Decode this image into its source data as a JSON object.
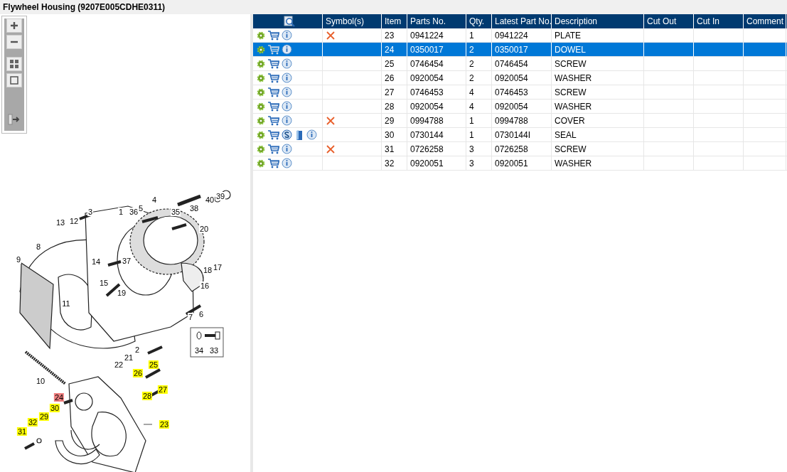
{
  "title": "Flywheel Housing (9207E005CDHE0311)",
  "diagram": {
    "callouts": [
      {
        "label": "4",
        "kind": "plain"
      },
      {
        "label": "40",
        "kind": "plain"
      },
      {
        "label": "39",
        "kind": "plain"
      },
      {
        "label": "3",
        "kind": "plain"
      },
      {
        "label": "1",
        "kind": "plain"
      },
      {
        "label": "36",
        "kind": "plain"
      },
      {
        "label": "5",
        "kind": "plain"
      },
      {
        "label": "35",
        "kind": "plain"
      },
      {
        "label": "38",
        "kind": "plain"
      },
      {
        "label": "13",
        "kind": "plain"
      },
      {
        "label": "12",
        "kind": "plain"
      },
      {
        "label": "20",
        "kind": "plain"
      },
      {
        "label": "8",
        "kind": "plain"
      },
      {
        "label": "9",
        "kind": "plain"
      },
      {
        "label": "14",
        "kind": "plain"
      },
      {
        "label": "37",
        "kind": "plain"
      },
      {
        "label": "18",
        "kind": "plain"
      },
      {
        "label": "17",
        "kind": "plain"
      },
      {
        "label": "15",
        "kind": "plain"
      },
      {
        "label": "16",
        "kind": "plain"
      },
      {
        "label": "19",
        "kind": "plain"
      },
      {
        "label": "11",
        "kind": "plain"
      },
      {
        "label": "7",
        "kind": "plain"
      },
      {
        "label": "6",
        "kind": "plain"
      },
      {
        "label": "2",
        "kind": "plain"
      },
      {
        "label": "34",
        "kind": "plain"
      },
      {
        "label": "33",
        "kind": "plain"
      },
      {
        "label": "21",
        "kind": "plain"
      },
      {
        "label": "22",
        "kind": "plain"
      },
      {
        "label": "25",
        "kind": "listed"
      },
      {
        "label": "26",
        "kind": "listed"
      },
      {
        "label": "10",
        "kind": "plain"
      },
      {
        "label": "27",
        "kind": "listed"
      },
      {
        "label": "24",
        "kind": "selected"
      },
      {
        "label": "28",
        "kind": "listed"
      },
      {
        "label": "30",
        "kind": "listed"
      },
      {
        "label": "29",
        "kind": "listed"
      },
      {
        "label": "32",
        "kind": "listed"
      },
      {
        "label": "23",
        "kind": "listed"
      },
      {
        "label": "31",
        "kind": "listed"
      }
    ]
  },
  "table": {
    "columns": [
      "Symbol(s)",
      "Item",
      "Parts No.",
      "Qty.",
      "Latest Part No.",
      "Description",
      "Cut Out",
      "Cut In",
      "Comment"
    ],
    "rows": [
      {
        "item": "23",
        "parts_no": "0941224",
        "qty": "1",
        "latest_part_no": "0941224",
        "description": "PLATE",
        "flagged": true,
        "extra_docs": false,
        "selected": false
      },
      {
        "item": "24",
        "parts_no": "0350017",
        "qty": "2",
        "latest_part_no": "0350017",
        "description": "DOWEL",
        "flagged": false,
        "extra_docs": false,
        "selected": true
      },
      {
        "item": "25",
        "parts_no": "0746454",
        "qty": "2",
        "latest_part_no": "0746454",
        "description": "SCREW",
        "flagged": false,
        "extra_docs": false,
        "selected": false
      },
      {
        "item": "26",
        "parts_no": "0920054",
        "qty": "2",
        "latest_part_no": "0920054",
        "description": "WASHER",
        "flagged": false,
        "extra_docs": false,
        "selected": false
      },
      {
        "item": "27",
        "parts_no": "0746453",
        "qty": "4",
        "latest_part_no": "0746453",
        "description": "SCREW",
        "flagged": false,
        "extra_docs": false,
        "selected": false
      },
      {
        "item": "28",
        "parts_no": "0920054",
        "qty": "4",
        "latest_part_no": "0920054",
        "description": "WASHER",
        "flagged": false,
        "extra_docs": false,
        "selected": false
      },
      {
        "item": "29",
        "parts_no": "0994788",
        "qty": "1",
        "latest_part_no": "0994788",
        "description": "COVER",
        "flagged": true,
        "extra_docs": false,
        "selected": false
      },
      {
        "item": "30",
        "parts_no": "0730144",
        "qty": "1",
        "latest_part_no": "0730144I",
        "description": "SEAL",
        "flagged": false,
        "extra_docs": true,
        "selected": false
      },
      {
        "item": "31",
        "parts_no": "0726258",
        "qty": "3",
        "latest_part_no": "0726258",
        "description": "SCREW",
        "flagged": true,
        "extra_docs": false,
        "selected": false
      },
      {
        "item": "32",
        "parts_no": "0920051",
        "qty": "3",
        "latest_part_no": "0920051",
        "description": "WASHER",
        "flagged": false,
        "extra_docs": false,
        "selected": false
      }
    ]
  }
}
